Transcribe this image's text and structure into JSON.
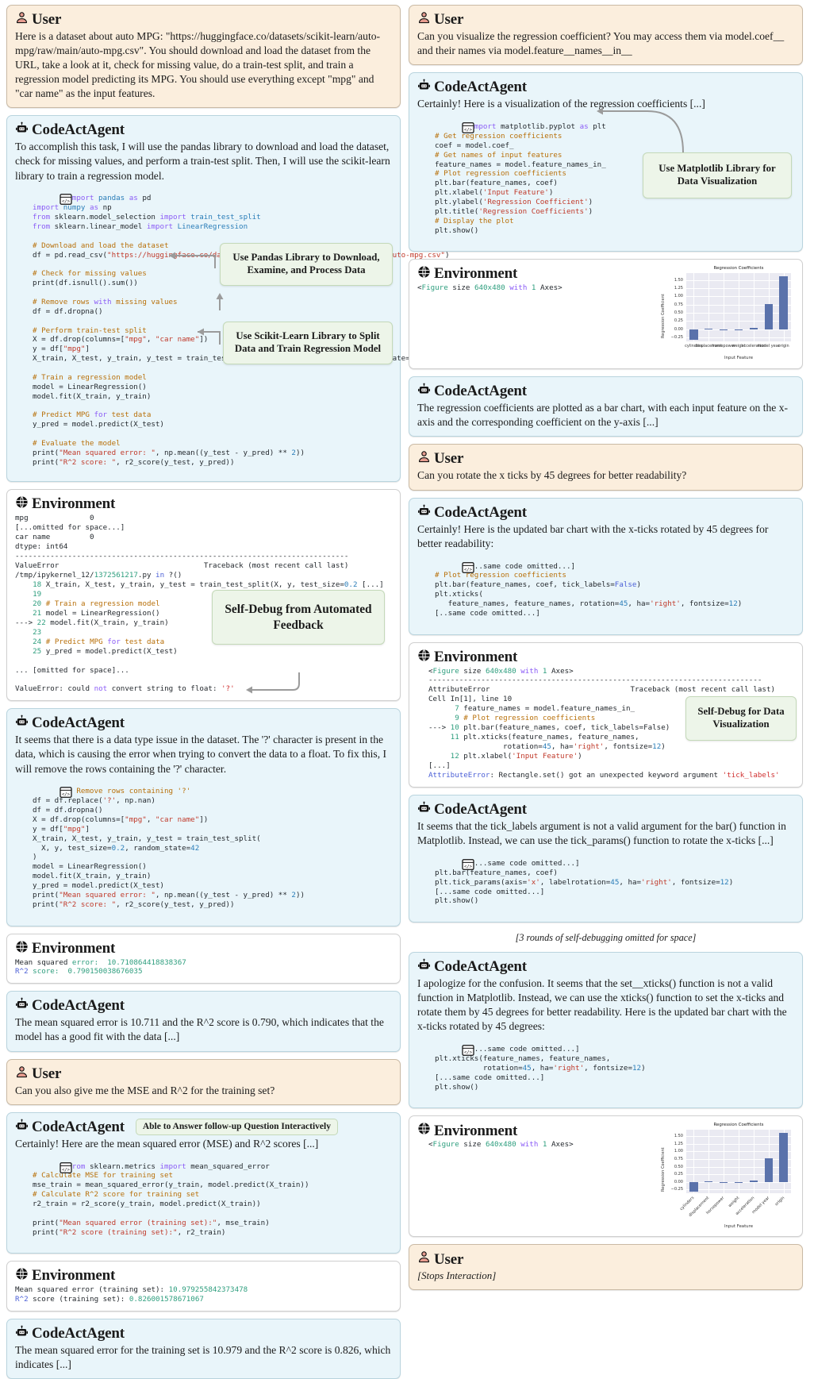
{
  "roles": {
    "user": "User",
    "agent": "CodeActAgent",
    "env": "Environment"
  },
  "left": {
    "turn1_user": "Here is a dataset about auto MPG: \"https://huggingface.co/datasets/scikit-learn/auto-mpg/raw/main/auto-mpg.csv\". You should download and load the dataset from the URL, take a look at it, check for missing value, do a train-test split, and train a regression model predicting its MPG. You should use everything except \"mpg\" and \"car name\" as the input features.",
    "turn2_agent_text": "To accomplish this task, I will use the pandas library to download and load the dataset, check for missing values, and perform a train-test split. Then, I will use the scikit-learn library to train a regression model.",
    "callout_pandas": "Use Pandas Library to Download, Examine, and Process Data",
    "callout_sklearn": "Use Scikit-Learn Library to Split Data and Train Regression Model",
    "callout_selfdebug": "Self-Debug from Automated Feedback",
    "turn4_agent_text": "It seems that there is a data type issue in the dataset. The '?' character is present in the data, which is causing the error when trying to convert the data to a float. To fix this, I will remove the rows containing the '?' character.",
    "turn6_agent_text": "The mean squared error is 10.711 and the R^2 score is 0.790, which indicates that the model has a good fit with the data [...]",
    "turn7_user": "Can you also give me the MSE and R^2 for the training set?",
    "badge_followup": "Able to Answer follow-up Question Interactively",
    "turn8_agent_text": "Certainly! Here are the mean squared error (MSE) and R^2 scores [...]",
    "turn10_agent_text": "The mean squared error for the training set is 10.979 and the R^2 score is 0.826, which indicates [...]"
  },
  "right": {
    "turn1_user": "Can you visualize the regression coefficient? You may access them via model.coef__ and their names via model.feature__names__in__",
    "turn2_agent_text": "Certainly! Here is a visualization of the regression coefficients [...]",
    "callout_matplotlib": "Use Matplotlib Library for Data Visualization",
    "figure_repr": "<Figure size 640x480 with 1 Axes>",
    "turn4_agent_text": "The regression coefficients are plotted as a bar chart, with each input feature on the x-axis and the corresponding coefficient on the y-axis [...]",
    "turn5_user": "Can you rotate the x ticks by 45 degrees for better readability?",
    "turn6_agent_text": "Certainly! Here is the updated bar chart with the x-ticks rotated by 45 degrees for better readability:",
    "callout_selfdebug_viz": "Self-Debug for Data Visualization",
    "turn8_agent_text": "It seems that the tick_labels argument is not a valid argument for the bar() function in Matplotlib. Instead, we can use the tick_params() function to rotate the x-ticks [...]",
    "omitted_note": "[3 rounds of self-debugging omitted for space]",
    "turn10_agent_text": "I apologize for the confusion. It seems that the set__xticks() function is not a valid function in Matplotlib. Instead, we can use the xticks() function to set the x-ticks and rotate them by 45 degrees for better readability. Here is the updated bar chart with the x-ticks rotated by 45 degrees:",
    "turn12_user": "[Stops Interaction]"
  },
  "env_outputs": {
    "missing_values": "mpg              0\n[...omitted for space...]\ncar name         0\ndtype: int64",
    "divider": "----------------------------------------------------------------------------",
    "traceback_head_err": "ValueError",
    "traceback_head_tb": "Traceback (most recent call last)",
    "traceback_file": "/tmp/ipykernel_12/1372561217.py in ?()",
    "traceback_lines": [
      "    18 X_train, X_test, y_train, y_test = train_test_split(X, y, test_size=0.2 [...]",
      "    19",
      "    20 # Train a regression model",
      "    21 model = LinearRegression()",
      "---> 22 model.fit(X_train, y_train)",
      "    23",
      "    24 # Predict MPG for test data",
      "    25 y_pred = model.predict(X_test)"
    ],
    "traceback_omitted": "... [omitted for space]...",
    "value_error_final": "ValueError: could not convert string to float: '?'",
    "metrics_test": "Mean squared error:  10.710864418838367\nR^2 score:  0.790150038676035",
    "metrics_train": "Mean squared error (training set): 10.979255842373478\nR^2 score (training set): 0.826001578671067",
    "attr_err_head": "AttributeError",
    "attr_err_tb": "Traceback (most recent call last)",
    "attr_err_cell": "Cell In[1], line 10",
    "attr_err_lines": [
      "      7 feature_names = model.feature_names_in_",
      "      9 # Plot regression coefficients",
      "---> 10 plt.bar(feature_names, coef, tick_labels=False)",
      "     11 plt.xticks(feature_names, feature_names,",
      "                  rotation=45, ha='right', fontsize=12)",
      "     12 plt.xlabel('Input Feature')"
    ],
    "attr_err_ellipsis": "[...]",
    "attr_err_final": "AttributeError: Rectangle.set() got an unexpected keyword argument 'tick_labels'"
  },
  "code": {
    "block1": "import pandas as pd\nimport numpy as np\nfrom sklearn.model_selection import train_test_split\nfrom sklearn.linear_model import LinearRegression\n\n# Download and load the dataset\ndf = pd.read_csv(\"https://huggingface.co/datasets/scikit-learn/auto-mpg/raw/main/auto-mpg.csv\")\n\n# Check for missing values\nprint(df.isnull().sum())\n\n# Remove rows with missing values\ndf = df.dropna()\n\n# Perform train-test split\nX = df.drop(columns=[\"mpg\", \"car name\"])\ny = df[\"mpg\"]\nX_train, X_test, y_train, y_test = train_test_split(X, y, test_size=0.2, random_state=42)\n\n# Train a regression model\nmodel = LinearRegression()\nmodel.fit(X_train, y_train)\n\n# Predict MPG for test data\ny_pred = model.predict(X_test)\n\n# Evaluate the model\nprint(\"Mean squared error: \", np.mean((y_test - y_pred) ** 2))\nprint(\"R^2 score: \", r2_score(y_test, y_pred))",
    "block2": "# Remove rows containing '?'\ndf = df.replace('?', np.nan)\ndf = df.dropna()\nX = df.drop(columns=[\"mpg\", \"car name\"])\ny = df[\"mpg\"]\nX_train, X_test, y_train, y_test = train_test_split(\n  X, y, test_size=0.2, random_state=42\n)\nmodel = LinearRegression()\nmodel.fit(X_train, y_train)\ny_pred = model.predict(X_test)\nprint(\"Mean squared error: \", np.mean((y_test - y_pred) ** 2))\nprint(\"R^2 score: \", r2_score(y_test, y_pred))",
    "block3": "from sklearn.metrics import mean_squared_error\n# Calculate MSE for training set\nmse_train = mean_squared_error(y_train, model.predict(X_train))\n# Calculate R^2 score for training set\nr2_train = r2_score(y_train, model.predict(X_train))\n\nprint(\"Mean squared error (training set):\", mse_train)\nprint(\"R^2 score (training set):\", r2_train)",
    "block4": "import matplotlib.pyplot as plt\n# Get regression coefficients\ncoef = model.coef_\n# Get names of input features\nfeature_names = model.feature_names_in_\n# Plot regression coefficients\nplt.bar(feature_names, coef)\nplt.xlabel('Input Feature')\nplt.ylabel('Regression Coefficient')\nplt.title('Regression Coefficients')\n# Display the plot\nplt.show()",
    "block5": "[..same code omitted...]\n# Plot regression coefficients\nplt.bar(feature_names, coef, tick_labels=False)\nplt.xticks(\n   feature_names, feature_names, rotation=45, ha='right', fontsize=12)\n[..same code omitted...]",
    "block6": "[...same code omitted...]\nplt.bar(feature_names, coef)\nplt.tick_params(axis='x', labelrotation=45, ha='right', fontsize=12)\n[...same code omitted...]\nplt.show()",
    "block7": "[...same code omitted...]\nplt.xticks(feature_names, feature_names,\n           rotation=45, ha='right', fontsize=12)\n[...same code omitted...]\nplt.show()"
  },
  "chart_data": [
    {
      "type": "bar",
      "id": "chart-flat-ticks",
      "title": "Regression Coefficients",
      "xlabel": "Input Feature",
      "ylabel": "Regression Coefficient",
      "categories": [
        "cylinders",
        "displacement",
        "horsepower",
        "weight",
        "acceleration",
        "model year",
        "origin"
      ],
      "values": [
        -0.32,
        0.012,
        -0.02,
        -0.005,
        0.04,
        0.77,
        1.6
      ],
      "yticks": [
        1.5,
        1.25,
        1.0,
        0.75,
        0.5,
        0.25,
        0.0,
        -0.25
      ],
      "ylim": [
        -0.38,
        1.7
      ],
      "grid": true,
      "tick_rotation": 0,
      "bar_color": "#5a72ab"
    },
    {
      "type": "bar",
      "id": "chart-rotated-ticks",
      "title": "Regression Coefficients",
      "xlabel": "Input Feature",
      "ylabel": "Regression Coefficient",
      "categories": [
        "cylinders",
        "displacement",
        "horsepower",
        "weight",
        "acceleration",
        "model year",
        "origin"
      ],
      "values": [
        -0.32,
        0.012,
        -0.02,
        -0.005,
        0.04,
        0.77,
        1.6
      ],
      "yticks": [
        1.5,
        1.25,
        1.0,
        0.75,
        0.5,
        0.25,
        0.0,
        -0.25
      ],
      "ylim": [
        -0.38,
        1.7
      ],
      "grid": true,
      "tick_rotation": 45,
      "bar_color": "#5a72ab"
    }
  ]
}
